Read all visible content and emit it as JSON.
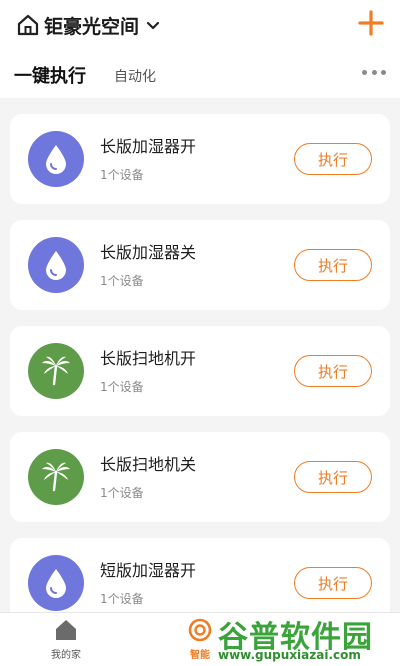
{
  "header": {
    "home_name": "钜豪光空间",
    "tab_active": "一键执行",
    "tab_other": "自动化"
  },
  "scenes": [
    {
      "name": "长版加湿器开",
      "devices": "1个设备",
      "icon": "water-drop-icon",
      "color": "#6f76dc",
      "action": "执行"
    },
    {
      "name": "长版加湿器关",
      "devices": "1个设备",
      "icon": "water-drop-icon",
      "color": "#6f76dc",
      "action": "执行"
    },
    {
      "name": "长版扫地机开",
      "devices": "1个设备",
      "icon": "palm-tree-icon",
      "color": "#5f9c4a",
      "action": "执行"
    },
    {
      "name": "长版扫地机关",
      "devices": "1个设备",
      "icon": "palm-tree-icon",
      "color": "#5f9c4a",
      "action": "执行"
    },
    {
      "name": "短版加湿器开",
      "devices": "1个设备",
      "icon": "water-drop-icon",
      "color": "#6f76dc",
      "action": "执行"
    }
  ],
  "tabbar": {
    "home_label": "我的家",
    "smart_label": "智能"
  },
  "watermark": {
    "title": "谷普软件园",
    "url": "www.gupuxiazai.com"
  },
  "colors": {
    "accent": "#f07c24",
    "drop": "#6f76dc",
    "palm": "#5f9c4a"
  }
}
